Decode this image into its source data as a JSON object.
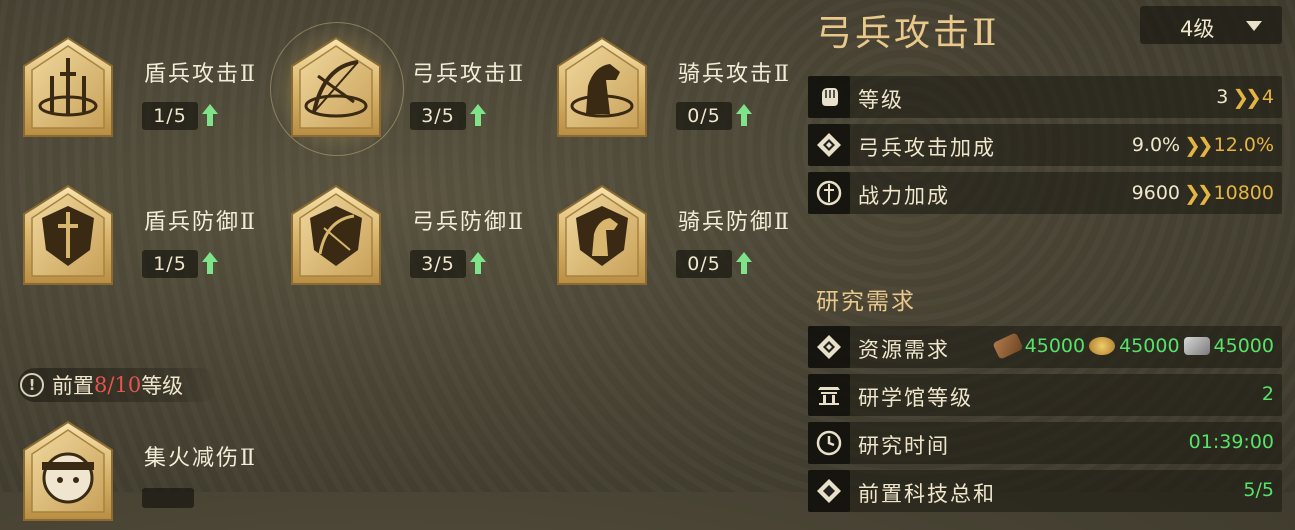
{
  "skills": [
    {
      "id": "shield-attack",
      "title": "盾兵攻击Ⅱ",
      "level": "1/5"
    },
    {
      "id": "archer-attack",
      "title": "弓兵攻击Ⅱ",
      "level": "3/5"
    },
    {
      "id": "cavalry-attack",
      "title": "骑兵攻击Ⅱ",
      "level": "0/5"
    },
    {
      "id": "shield-defense",
      "title": "盾兵防御Ⅱ",
      "level": "1/5"
    },
    {
      "id": "archer-defense",
      "title": "弓兵防御Ⅱ",
      "level": "3/5"
    },
    {
      "id": "cavalry-defense",
      "title": "骑兵防御Ⅱ",
      "level": "0/5"
    },
    {
      "id": "focus-fire",
      "title": "集火减伤Ⅱ",
      "level": ""
    }
  ],
  "prereq": {
    "label_prefix": "前置",
    "current": "8",
    "separator": "/",
    "total": "10",
    "label_suffix": "等级"
  },
  "detail": {
    "title": "弓兵攻击Ⅱ",
    "level_dropdown": "4级",
    "stats": [
      {
        "label": "等级",
        "current": "3",
        "next": "4",
        "icon": "fist-icon"
      },
      {
        "label": "弓兵攻击加成",
        "current": "9.0%",
        "next": "12.0%",
        "icon": "diamond-icon"
      },
      {
        "label": "战力加成",
        "current": "9600",
        "next": "10800",
        "icon": "sword-circle-icon"
      }
    ],
    "requirements_title": "研究需求",
    "requirements": [
      {
        "label": "资源需求",
        "icon": "diamond-icon",
        "resources": [
          {
            "icon": "wood-icon",
            "amount": "45000"
          },
          {
            "icon": "coin-icon",
            "amount": "45000"
          },
          {
            "icon": "stone-icon",
            "amount": "45000"
          }
        ]
      },
      {
        "label": "研学馆等级",
        "icon": "building-icon",
        "value": "2"
      },
      {
        "label": "研究时间",
        "icon": "clock-icon",
        "value": "01:39:00"
      },
      {
        "label": "前置科技总和",
        "icon": "diamond-icon",
        "value": "5/5"
      }
    ]
  },
  "colors": {
    "gold": "#e9c98b",
    "green": "#56e36a",
    "red": "#e8544d",
    "arrow": "#e5b544"
  }
}
